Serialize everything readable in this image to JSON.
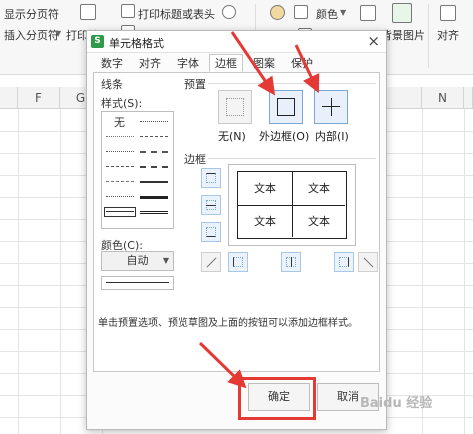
{
  "ribbon": {
    "display_pagination": "显示分页符",
    "insert_pagination": "插入分页符",
    "print_partial": "打印缩",
    "print_title": "打印标题或表头",
    "print_preview_label": "打印预览",
    "color": "颜色",
    "bg_image": "背景图片",
    "align": "对齐"
  },
  "columns": [
    "F",
    "G",
    "N"
  ],
  "dialog": {
    "title": "单元格格式",
    "close": "×",
    "tabs": [
      "数字",
      "对齐",
      "字体",
      "边框",
      "图案",
      "保护"
    ],
    "active_tab": "边框",
    "line_group": "线条",
    "style_label": "样式(S):",
    "style_none": "无",
    "color_label": "颜色(C):",
    "color_value": "自动",
    "preset_group": "预置",
    "presets": [
      "无(N)",
      "外边框(O)",
      "内部(I)"
    ],
    "border_group": "边框",
    "preview_text": [
      "文本",
      "文本",
      "文本",
      "文本"
    ],
    "hint": "单击预置选项、预览草图及上面的按钮可以添加边框样式。",
    "ok": "确定",
    "cancel": "取消"
  },
  "watermark": "Baidu 经验",
  "colors": {
    "highlight": "#e53935",
    "accent": "#2e9b4a"
  }
}
